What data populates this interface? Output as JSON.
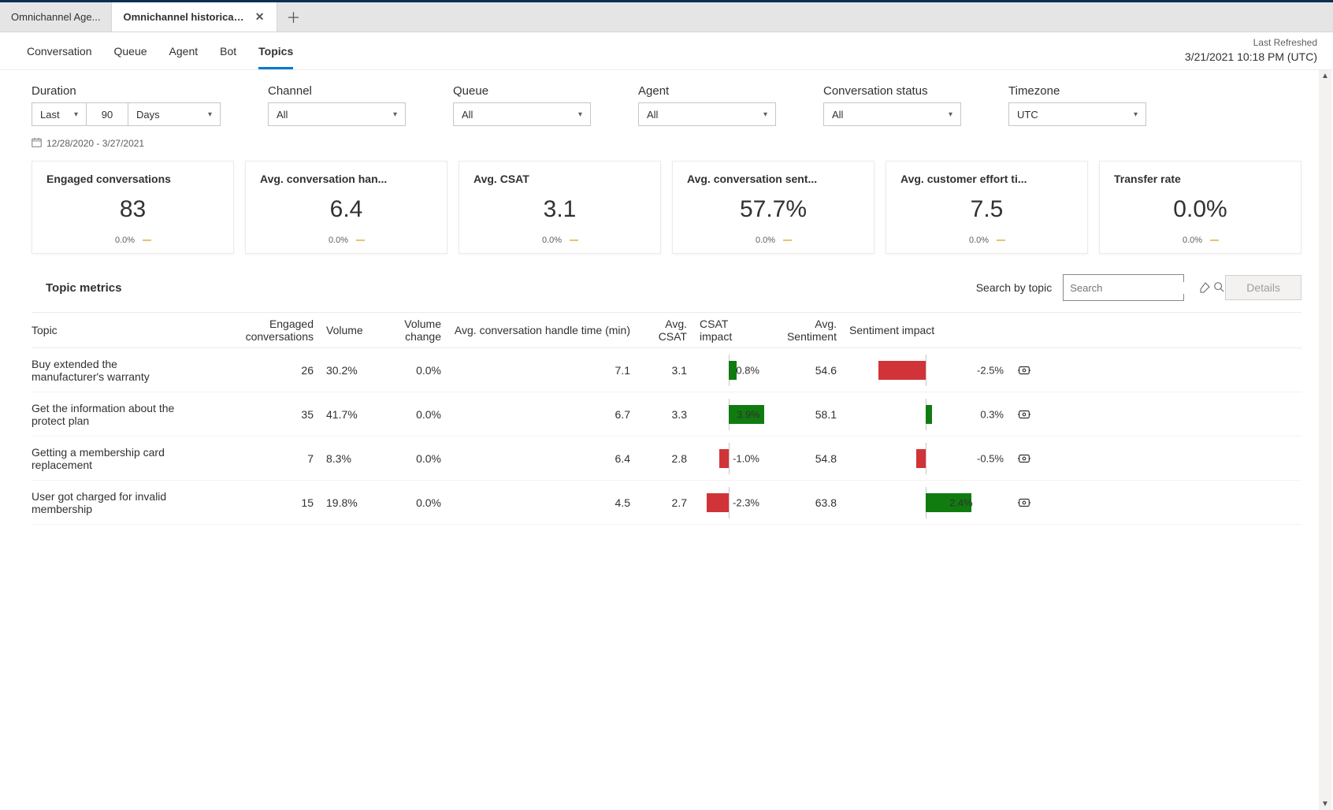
{
  "tabs": {
    "t0": "Omnichannel Age...",
    "t1": "Omnichannel historical an..."
  },
  "nav": {
    "conversation": "Conversation",
    "queue": "Queue",
    "agent": "Agent",
    "bot": "Bot",
    "topics": "Topics"
  },
  "refresh": {
    "label": "Last Refreshed",
    "ts": "3/21/2021 10:18 PM (UTC)"
  },
  "filters": {
    "duration_label": "Duration",
    "duration_last": "Last",
    "duration_count": "90",
    "duration_unit": "Days",
    "daterange": "12/28/2020 - 3/27/2021",
    "channel_label": "Channel",
    "channel_val": "All",
    "queue_label": "Queue",
    "queue_val": "All",
    "agent_label": "Agent",
    "agent_val": "All",
    "status_label": "Conversation status",
    "status_val": "All",
    "tz_label": "Timezone",
    "tz_val": "UTC"
  },
  "kpi": {
    "engaged_t": "Engaged conversations",
    "engaged_v": "83",
    "engaged_d": "0.0%",
    "handle_t": "Avg. conversation han...",
    "handle_v": "6.4",
    "handle_d": "0.0%",
    "csat_t": "Avg. CSAT",
    "csat_v": "3.1",
    "csat_d": "0.0%",
    "sent_t": "Avg. conversation sent...",
    "sent_v": "57.7%",
    "sent_d": "0.0%",
    "effort_t": "Avg. customer effort ti...",
    "effort_v": "7.5",
    "effort_d": "0.0%",
    "xfer_t": "Transfer rate",
    "xfer_v": "0.0%",
    "xfer_d": "0.0%"
  },
  "tm": {
    "title": "Topic metrics",
    "search_label": "Search by topic",
    "search_ph": "Search",
    "details": "Details"
  },
  "th": {
    "topic": "Topic",
    "eng": "Engaged conversations",
    "vol": "Volume",
    "volchg": "Volume change",
    "handle": "Avg. conversation handle time (min)",
    "csat": "Avg. CSAT",
    "csati": "CSAT impact",
    "sent": "Avg. Sentiment",
    "senti": "Sentiment impact"
  },
  "rows": {
    "r0": {
      "topic": "Buy extended the manufacturer's warranty",
      "eng": "26",
      "vol": "30.2%",
      "volchg": "0.0%",
      "handle": "7.1",
      "csat": "3.1",
      "csati": "0.8%",
      "sent": "54.6",
      "senti": "-2.5%"
    },
    "r1": {
      "topic": "Get the information about the protect plan",
      "eng": "35",
      "vol": "41.7%",
      "volchg": "0.0%",
      "handle": "6.7",
      "csat": "3.3",
      "csati": "3.9%",
      "sent": "58.1",
      "senti": "0.3%"
    },
    "r2": {
      "topic": "Getting a membership card replacement",
      "eng": "7",
      "vol": "8.3%",
      "volchg": "0.0%",
      "handle": "6.4",
      "csat": "2.8",
      "csati": "-1.0%",
      "sent": "54.8",
      "senti": "-0.5%"
    },
    "r3": {
      "topic": "User got charged for invalid membership",
      "eng": "15",
      "vol": "19.8%",
      "volchg": "0.0%",
      "handle": "4.5",
      "csat": "2.7",
      "csati": "-2.3%",
      "sent": "63.8",
      "senti": "2.4%"
    }
  },
  "chart_data": [
    {
      "type": "bar",
      "title": "CSAT impact",
      "categories": [
        "Buy extended the manufacturer's warranty",
        "Get the information about the protect plan",
        "Getting a membership card replacement",
        "User got charged for invalid membership"
      ],
      "values": [
        0.8,
        3.9,
        -1.0,
        -2.3
      ],
      "xlabel": "",
      "ylabel": "CSAT impact (%)"
    },
    {
      "type": "bar",
      "title": "Sentiment impact",
      "categories": [
        "Buy extended the manufacturer's warranty",
        "Get the information about the protect plan",
        "Getting a membership card replacement",
        "User got charged for invalid membership"
      ],
      "values": [
        -2.5,
        0.3,
        -0.5,
        2.4
      ],
      "xlabel": "",
      "ylabel": "Sentiment impact (%)"
    }
  ]
}
